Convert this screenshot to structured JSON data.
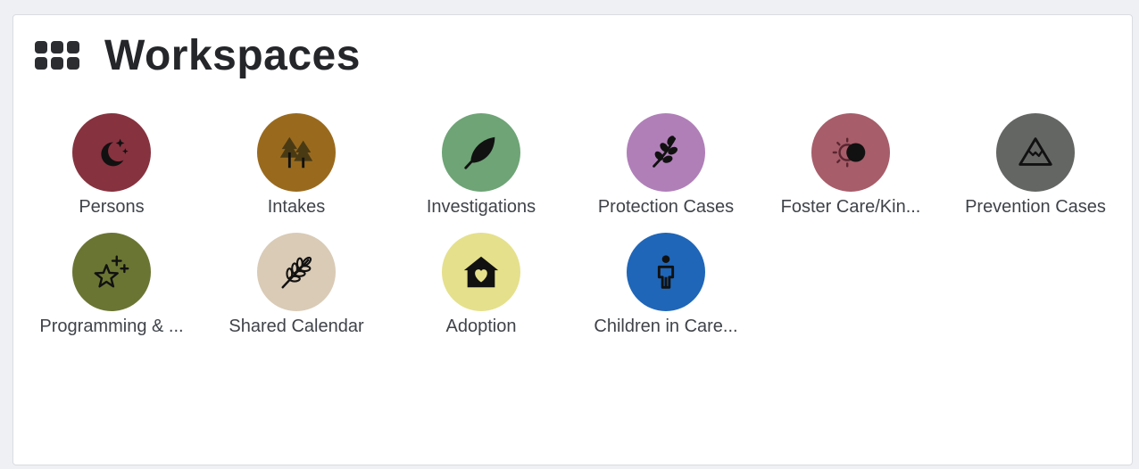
{
  "header": {
    "title": "Workspaces",
    "icon": "grid-icon"
  },
  "workspaces": [
    {
      "label": "Persons",
      "color": "#86323f",
      "icon": "moon-stars-icon"
    },
    {
      "label": "Intakes",
      "color": "#996a1e",
      "icon": "trees-icon"
    },
    {
      "label": "Investigations",
      "color": "#6ea476",
      "icon": "feather-icon"
    },
    {
      "label": "Protection Cases",
      "color": "#b07fb8",
      "icon": "sprig-icon"
    },
    {
      "label": "Foster Care/Kin...",
      "color": "#a75d6a",
      "icon": "eclipse-icon"
    },
    {
      "label": "Prevention Cases",
      "color": "#646664",
      "icon": "mountain-icon"
    },
    {
      "label": "Programming & ...",
      "color": "#6b7533",
      "icon": "sparkle-star-icon"
    },
    {
      "label": "Shared Calendar",
      "color": "#d9cbb6",
      "icon": "wheat-icon"
    },
    {
      "label": "Adoption",
      "color": "#e5e08c",
      "icon": "house-heart-icon"
    },
    {
      "label": "Children in Care...",
      "color": "#1f66b8",
      "icon": "child-icon"
    }
  ]
}
